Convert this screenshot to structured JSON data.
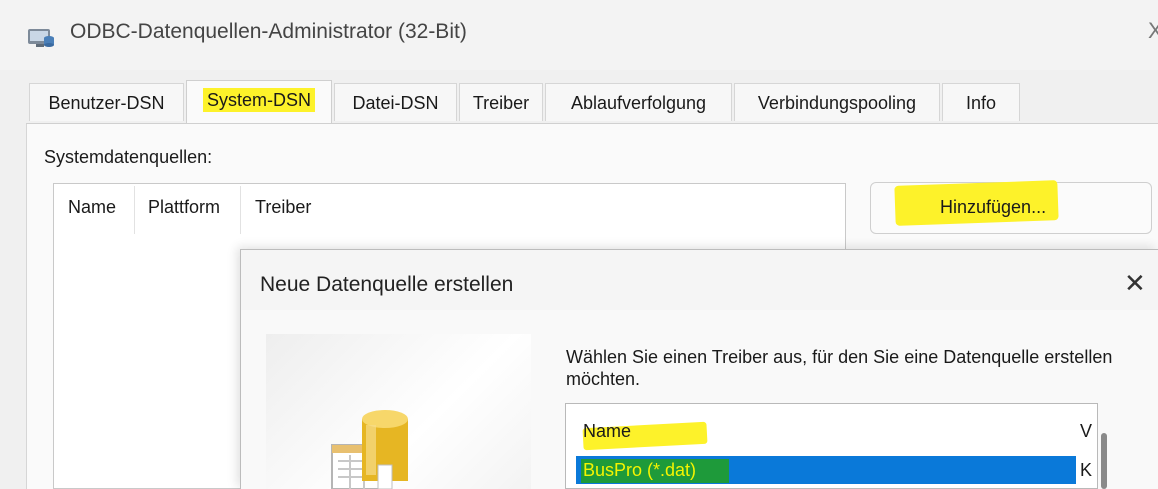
{
  "window": {
    "title": "ODBC-Datenquellen-Administrator (32-Bit)",
    "close_glyph": "X"
  },
  "tabs": [
    {
      "label": "Benutzer-DSN",
      "active": false
    },
    {
      "label": "System-DSN",
      "active": true
    },
    {
      "label": "Datei-DSN",
      "active": false
    },
    {
      "label": "Treiber",
      "active": false
    },
    {
      "label": "Ablaufverfolgung",
      "active": false
    },
    {
      "label": "Verbindungspooling",
      "active": false
    },
    {
      "label": "Info",
      "active": false
    }
  ],
  "system_dsn": {
    "label": "Systemdatenquellen:",
    "columns": [
      "Name",
      "Plattform",
      "Treiber"
    ],
    "add_button": "Hinzufügen..."
  },
  "dialog": {
    "title": "Neue Datenquelle erstellen",
    "close_glyph": "✕",
    "instruction": "Wählen Sie einen Treiber aus, für den Sie eine Datenquelle erstellen möchten.",
    "driver_columns": [
      "Name",
      "V"
    ],
    "drivers": [
      {
        "name": "BusPro (*.dat)",
        "version": "K",
        "selected": true
      }
    ]
  },
  "colors": {
    "highlight": "#fdf22a",
    "selection": "#0a79d9",
    "selection_annotation": "#1e9a3a"
  },
  "icons": {
    "app_icon": "odbc-admin-icon",
    "wizard_icon": "database-wizard-icon"
  }
}
